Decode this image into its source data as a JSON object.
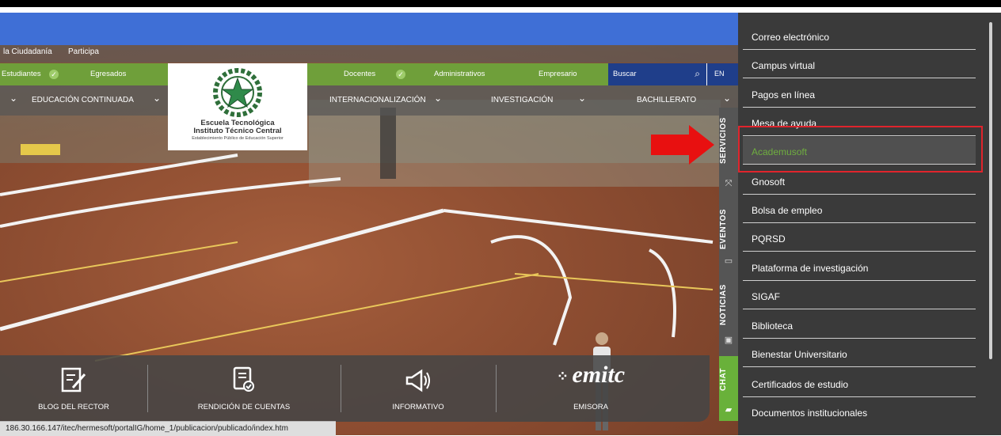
{
  "header": {
    "top_links": [
      "la Ciudadanía",
      "Participa"
    ],
    "audience_links": [
      "Estudiantes",
      "Egresados",
      "Docentes",
      "Administrativos",
      "Empresario"
    ],
    "search_placeholder": "Buscar",
    "lang_label": "EN"
  },
  "logo": {
    "line1": "Escuela Tecnológica",
    "line2": "Instituto Técnico Central",
    "line3": "Establecimiento Público de Educación Superior"
  },
  "mainnav": [
    "EDUCACIÓN CONTINUADA",
    "INTERNACIONALIZACIÓN",
    "INVESTIGACIÓN",
    "BACHILLERATO"
  ],
  "side_tabs": [
    "SERVICIOS",
    "EVENTOS",
    "NOTICIAS",
    "CHAT"
  ],
  "services_menu": {
    "items": [
      "Correo electrónico",
      "Campus virtual",
      "Pagos en línea",
      "Mesa de ayuda",
      "Academusoft",
      "Gnosoft",
      "Bolsa de empleo",
      "PQRSD",
      "Plataforma de investigación",
      "SIGAF",
      "Biblioteca",
      "Bienestar Universitario",
      "Certificados de estudio",
      "Documentos institucionales"
    ],
    "active_index": 4
  },
  "quick_links": {
    "blog": "BLOG DEL RECTOR",
    "rendicion": "RENDICIÓN DE CUENTAS",
    "informativo": "INFORMATIVO",
    "emisora": "EMISORA",
    "emitc": "emitc"
  },
  "status_url": "186.30.166.147/itec/hermesoft/portalIG/home_1/publicacion/publicado/index.htm",
  "colors": {
    "blue_bar": "#3f6fd6",
    "green": "#6f9f3a",
    "panel": "#3a3a3a",
    "highlight": "#e0242c",
    "active_text": "#6fae3f"
  },
  "icons": [
    "search-icon",
    "chevron-down-icon",
    "arrow-right-icon",
    "calendar-icon",
    "news-icon",
    "chat-icon",
    "edit-icon",
    "document-check-icon",
    "megaphone-icon"
  ]
}
